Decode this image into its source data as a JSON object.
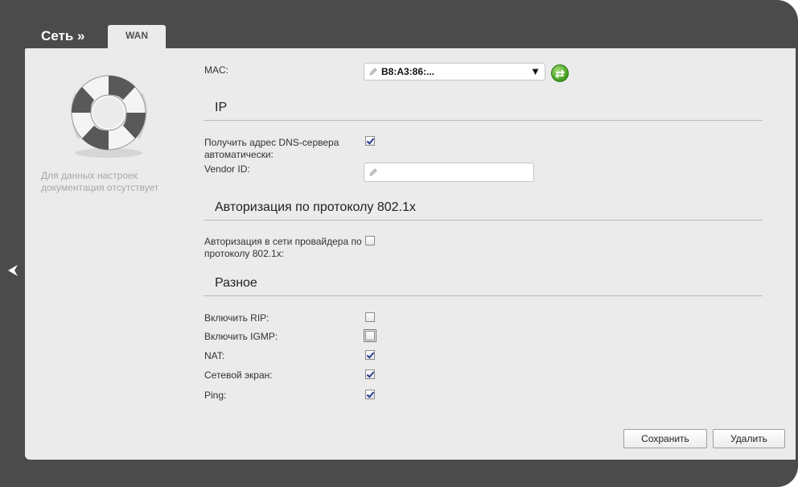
{
  "header": {
    "breadcrumb": "Сеть »",
    "active_tab": "WAN"
  },
  "sidebar": {
    "note": "Для данных настроек документация отсутствует",
    "help_icon": "lifebuoy-icon"
  },
  "mac": {
    "label": "MAC:",
    "value": "B8:A3:86:...",
    "refresh_icon": "refresh-icon"
  },
  "ip_section": {
    "title": "IP",
    "dns_auto_label": "Получить адрес DNS-сервера автоматически:",
    "dns_auto_checked": true,
    "vendor_id_label": "Vendor ID:",
    "vendor_id_value": ""
  },
  "auth_section": {
    "title": "Авторизация по протоколу 802.1x",
    "auth_label": "Авторизация в сети провайдера по протоколу 802.1x:",
    "auth_checked": false
  },
  "misc_section": {
    "title": "Разное",
    "rip_label": "Включить RIP:",
    "rip_checked": false,
    "igmp_label": "Включить IGMP:",
    "igmp_checked": false,
    "nat_label": "NAT:",
    "nat_checked": true,
    "firewall_label": "Сетевой экран:",
    "firewall_checked": true,
    "ping_label": "Ping:",
    "ping_checked": true
  },
  "buttons": {
    "save": "Сохранить",
    "delete": "Удалить"
  }
}
